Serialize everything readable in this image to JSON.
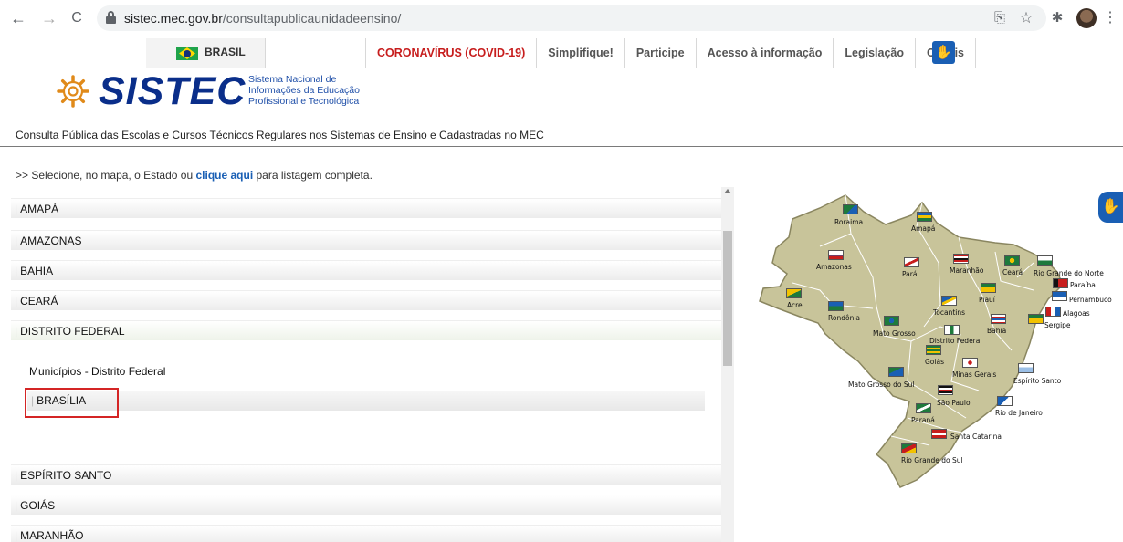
{
  "browser": {
    "url_host": "sistec.mec.gov.br",
    "url_path": "/consultapublicaunidadeensino/",
    "back_icon": "←",
    "forward_icon": "→",
    "reload_icon": "C",
    "share_icon": "⎘",
    "star_icon": "☆",
    "extensions_icon": "✱",
    "menu_icon": "⋮"
  },
  "gov_bar": {
    "brasil_label": "BRASIL",
    "links": [
      "CORONAVÍRUS (COVID-19)",
      "Simplifique!",
      "Participe",
      "Acesso à informação",
      "Legislação",
      "Canais"
    ],
    "a11y_icon": "✋",
    "colors": {
      "covid": "#c71d1d",
      "a11y": "#1a5fb4"
    }
  },
  "logo": {
    "word": "SISTEC",
    "subtitle_lines": [
      "Sistema Nacional de",
      "Informações da Educação",
      "Profissional e Tecnológica"
    ]
  },
  "page": {
    "description": "Consulta Pública das Escolas e Cursos Técnicos Regulares nos Sistemas de Ensino e Cadastradas no MEC",
    "instruction_prefix": ">> Selecione, no mapa, o Estado ou ",
    "instruction_link": "clique aqui",
    "instruction_suffix": " para listagem completa."
  },
  "state_list": {
    "states_before": [
      "AMAPÁ",
      "AMAZONAS",
      "BAHIA",
      "CEARÁ"
    ],
    "active_state": "DISTRITO FEDERAL",
    "municipalities_title": "Municípios - Distrito Federal",
    "city": "BRASÍLIA",
    "states_after": [
      "ESPÍRITO SANTO",
      "GOIÁS",
      "MARANHÃO"
    ]
  },
  "map": {
    "labels": [
      "Roraima",
      "Amapá",
      "Amazonas",
      "Pará",
      "Maranhão",
      "Ceará",
      "Rio Grande do Norte",
      "Paraíba",
      "Pernambuco",
      "Piauí",
      "Alagoas",
      "Acre",
      "Tocantins",
      "Sergipe",
      "Rondônia",
      "Bahia",
      "Mato Grosso",
      "Distrito Federal",
      "Goiás",
      "Minas Gerais",
      "Espírito Santo",
      "Mato Grosso do Sul",
      "São Paulo",
      "Rio de Janeiro",
      "Paraná",
      "Santa Catarina",
      "Rio Grande do Sul"
    ],
    "land_color": "#c8c49a",
    "border_color": "#ffffff"
  }
}
